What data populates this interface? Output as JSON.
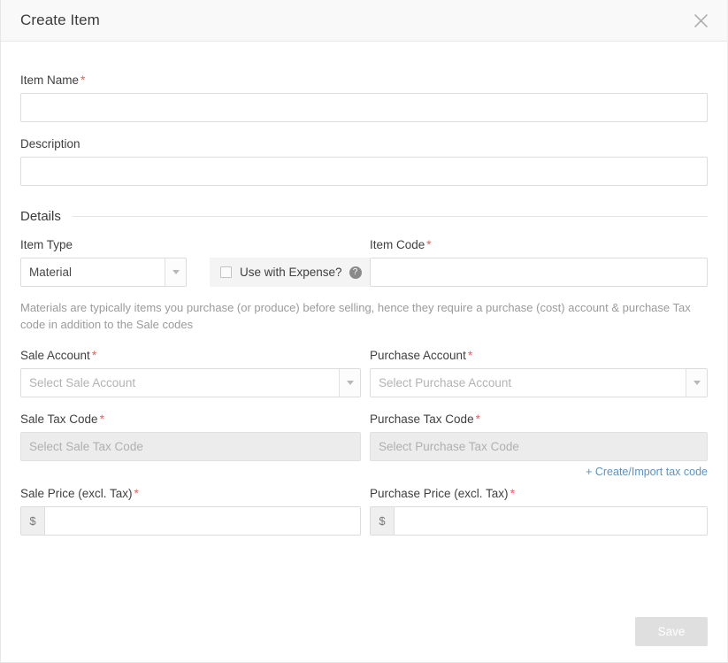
{
  "dialog": {
    "title": "Create Item",
    "close_icon": "close-icon"
  },
  "form": {
    "item_name": {
      "label": "Item Name",
      "required_marker": "*",
      "value": "",
      "placeholder": ""
    },
    "description": {
      "label": "Description",
      "value": "",
      "placeholder": ""
    },
    "details_section": {
      "title": "Details"
    },
    "item_type": {
      "label": "Item Type",
      "selected": "Material",
      "caret_icon": "chevron-down-icon"
    },
    "use_with_expense": {
      "label": "Use with Expense?",
      "checked": false,
      "help_icon": "help-circle-icon",
      "help_glyph": "?"
    },
    "item_code": {
      "label": "Item Code",
      "required_marker": "*",
      "value": "",
      "placeholder": ""
    },
    "helper_text": "Materials are typically items you purchase (or produce) before selling, hence they require a purchase (cost) account & purchase Tax code in addition to the Sale codes",
    "sale_account": {
      "label": "Sale Account",
      "required_marker": "*",
      "placeholder": "Select Sale Account",
      "selected": ""
    },
    "purchase_account": {
      "label": "Purchase Account",
      "required_marker": "*",
      "placeholder": "Select Purchase Account",
      "selected": ""
    },
    "sale_tax_code": {
      "label": "Sale Tax Code",
      "required_marker": "*",
      "placeholder": "Select Sale Tax Code",
      "selected": "",
      "disabled": true
    },
    "purchase_tax_code": {
      "label": "Purchase Tax Code",
      "required_marker": "*",
      "placeholder": "Select Purchase Tax Code",
      "selected": "",
      "disabled": true
    },
    "create_import_tax_code_link": "+ Create/Import tax code",
    "sale_price": {
      "label": "Sale Price (excl. Tax)",
      "required_marker": "*",
      "currency_symbol": "$",
      "value": "",
      "placeholder": ""
    },
    "purchase_price": {
      "label": "Purchase Price (excl. Tax)",
      "required_marker": "*",
      "currency_symbol": "$",
      "value": "",
      "placeholder": ""
    }
  },
  "footer": {
    "save_label": "Save",
    "save_disabled": true
  },
  "colors": {
    "required_asterisk": "#e8615a",
    "link": "#5a93c4",
    "header_bg": "#f9f9f9",
    "disabled_field_bg": "#ececec",
    "save_disabled_bg": "#dfdfdf",
    "help_icon_bg": "#8a8a8a"
  }
}
